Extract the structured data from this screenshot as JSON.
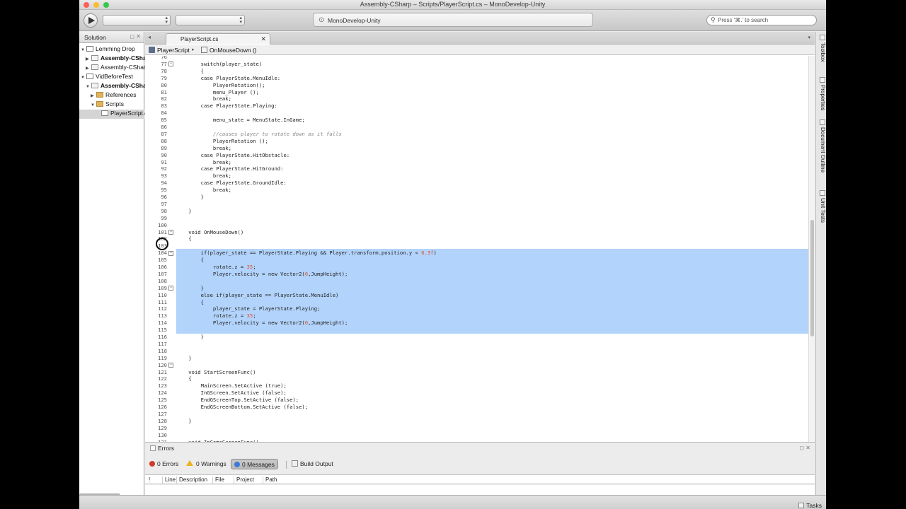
{
  "window": {
    "title": "Assembly-CSharp – Scripts/PlayerScript.cs – MonoDevelop-Unity",
    "traffic_light_colors": [
      "#fc5f57",
      "#fdbc2e",
      "#34c84a"
    ]
  },
  "toolbar": {
    "status_text": "MonoDevelop-Unity",
    "search_placeholder": "Press '⌘.' to search"
  },
  "solution": {
    "title": "Solution",
    "items": [
      {
        "label": "Lemming Drop",
        "indent": 0,
        "expanded": true,
        "bold": false,
        "icon": "solution-icon"
      },
      {
        "label": "Assembly-CSharp",
        "indent": 1,
        "expanded": false,
        "bold": true,
        "icon": "project-icon"
      },
      {
        "label": "Assembly-CSharp",
        "indent": 1,
        "expanded": false,
        "bold": false,
        "icon": "project-icon"
      },
      {
        "label": "VidBeforeTest",
        "indent": 0,
        "expanded": true,
        "bold": false,
        "icon": "solution-icon"
      },
      {
        "label": "Assembly-CSharp",
        "indent": 1,
        "expanded": true,
        "bold": true,
        "icon": "project-icon"
      },
      {
        "label": "References",
        "indent": 2,
        "expanded": false,
        "bold": false,
        "icon": "folder-icon"
      },
      {
        "label": "Scripts",
        "indent": 2,
        "expanded": true,
        "bold": false,
        "icon": "folder-icon"
      },
      {
        "label": "PlayerScript.cs",
        "indent": 3,
        "expanded": null,
        "bold": false,
        "icon": "file-icon"
      }
    ]
  },
  "editor": {
    "tab_label": "PlayerScript.cs",
    "path_class": "PlayerScript",
    "path_method": "OnMouseDown ()",
    "first_line": 76,
    "selection_lines": [
      104,
      115
    ],
    "fold_lines": [
      77,
      101,
      104,
      109,
      120
    ],
    "lines": [
      "",
      "        switch(player_state)",
      "        {",
      "        case PlayerState.MenuIdle:",
      "            PlayerRotation();",
      "            menu_Player ();",
      "            break;",
      "        case PlayerState.Playing:",
      "",
      "            menu_state = MenuState.InGame;",
      "",
      "            //causes player to rotate down as it falls",
      "            PlayerRotation ();",
      "            break;",
      "        case PlayerState.HitObstacle:",
      "            break;",
      "        case PlayerState.HitGround:",
      "            break;",
      "        case PlayerState.GroundIdle:",
      "            break;",
      "        }",
      "",
      "    }",
      "",
      "",
      "    void OnMouseDown()",
      "    {",
      "",
      "        if(player_state == PlayerState.Playing && Player.transform.position.y < 6.3f)",
      "        {",
      "            rotate.z = 35;",
      "            Player.velocity = new Vector2(0,JumpHeight);",
      "",
      "        }",
      "        else if(player_state == PlayerState.MenuIdle)",
      "        {",
      "            player_state = PlayerState.Playing;",
      "            rotate.z = 35;",
      "            Player.velocity = new Vector2(0,JumpHeight);",
      "",
      "        }",
      "",
      "",
      "    }",
      "",
      "    void StartScreenFunc()",
      "    {",
      "        MainScreen.SetActive (true);",
      "        InGScreen.SetActive (false);",
      "        EndGScreenTop.SetActive (false);",
      "        EndGScreenBottom.SetActive (false);",
      "",
      "    }",
      "",
      "",
      "    void InGameScreenFunc()"
    ],
    "selection_color": "#b2d3fb",
    "number_color": "#e0502a",
    "comment_color": "#8a8a8a"
  },
  "right_dock": {
    "tabs": [
      "Toolbox",
      "Properties",
      "Document Outline",
      "Unit Tests"
    ]
  },
  "errors": {
    "title": "Errors",
    "errors_label": "0 Errors",
    "warnings_label": "0 Warnings",
    "messages_label": "0 Messages",
    "build_output_label": "Build Output",
    "columns": [
      "!",
      "Line",
      "Description",
      "File",
      "Project",
      "Path"
    ]
  },
  "statusbar": {
    "tasks_label": "Tasks"
  }
}
